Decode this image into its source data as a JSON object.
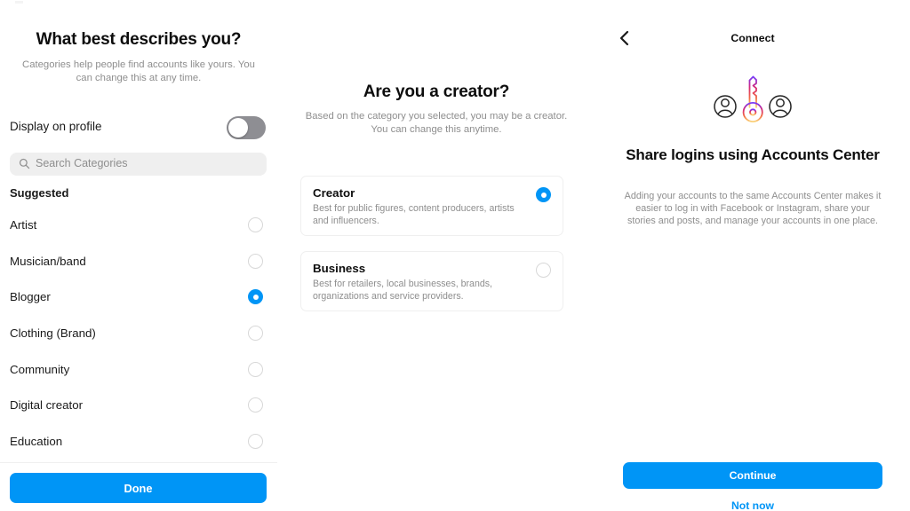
{
  "panels": {
    "category": {
      "title": "What best describes you?",
      "subtitle": "Categories help people find accounts like yours. You can change this at any time.",
      "toggle": {
        "label": "Display on profile",
        "state": "off"
      },
      "search": {
        "placeholder": "Search Categories",
        "value": "",
        "icon": "search-icon"
      },
      "section_header": "Suggested",
      "categories": [
        {
          "label": "Artist",
          "selected": false
        },
        {
          "label": "Musician/band",
          "selected": false
        },
        {
          "label": "Blogger",
          "selected": true
        },
        {
          "label": "Clothing (Brand)",
          "selected": false
        },
        {
          "label": "Community",
          "selected": false
        },
        {
          "label": "Digital creator",
          "selected": false
        },
        {
          "label": "Education",
          "selected": false
        }
      ],
      "primary_button": "Done"
    },
    "creator": {
      "title": "Are you a creator?",
      "subtitle": "Based on the category you selected, you may be a creator. You can change this anytime.",
      "options": [
        {
          "title": "Creator",
          "description": "Best for public figures, content producers, artists and influencers.",
          "selected": true
        },
        {
          "title": "Business",
          "description": "Best for retailers, local businesses, brands, organizations and service providers.",
          "selected": false
        }
      ]
    },
    "connect": {
      "nav_title": "Connect",
      "back_icon": "chevron-left-icon",
      "hero_icon": "accounts-center-key-icon",
      "title": "Share logins using Accounts Center",
      "body": "Adding your accounts to the same Accounts Center makes it easier to log in with Facebook or Instagram, share your stories and posts, and manage your accounts in one place.",
      "primary_button": "Continue",
      "secondary_button": "Not now"
    }
  },
  "colors": {
    "accent_blue": "#0095f6",
    "text_primary": "#0d0d0d",
    "text_secondary": "#8e8e8e",
    "field_bg": "#efefef",
    "toggle_off": "#8e8e93",
    "gradient_purple": "#7638fa",
    "gradient_pink": "#d82e7c",
    "gradient_orange": "#f9ce34"
  }
}
